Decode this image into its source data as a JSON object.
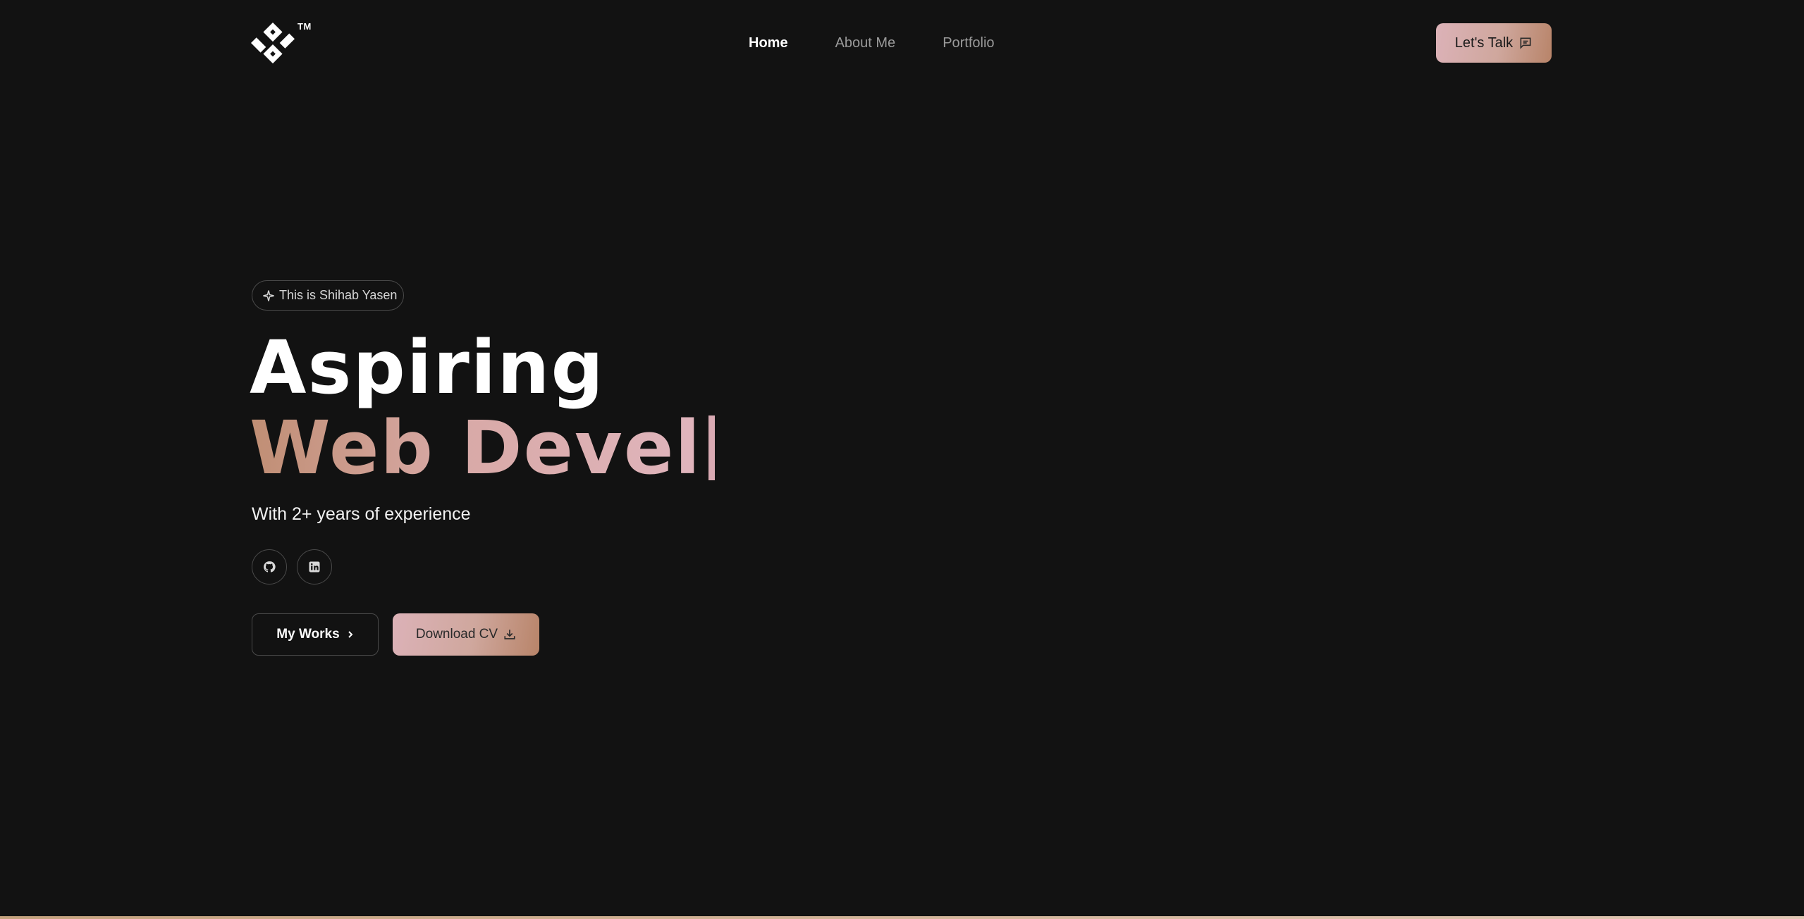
{
  "header": {
    "logo_mark": "S",
    "trademark": "TM",
    "nav": [
      {
        "label": "Home",
        "active": true
      },
      {
        "label": "About Me",
        "active": false
      },
      {
        "label": "Portfolio",
        "active": false
      }
    ],
    "cta_label": "Let's Talk"
  },
  "hero": {
    "badge": "This is Shihab Yasen",
    "headline_line1": "Aspiring",
    "headline_line2_typed": "Web Devel",
    "subline": "With 2+ years of experience",
    "social": [
      "github-icon",
      "linkedin-icon"
    ],
    "primary_button": "My Works",
    "secondary_button": "Download CV"
  },
  "colors": {
    "background": "#121212",
    "accent_gradient_start": "#dcb2b8",
    "accent_gradient_end": "#b88469",
    "text_muted": "#9a9a9a"
  }
}
